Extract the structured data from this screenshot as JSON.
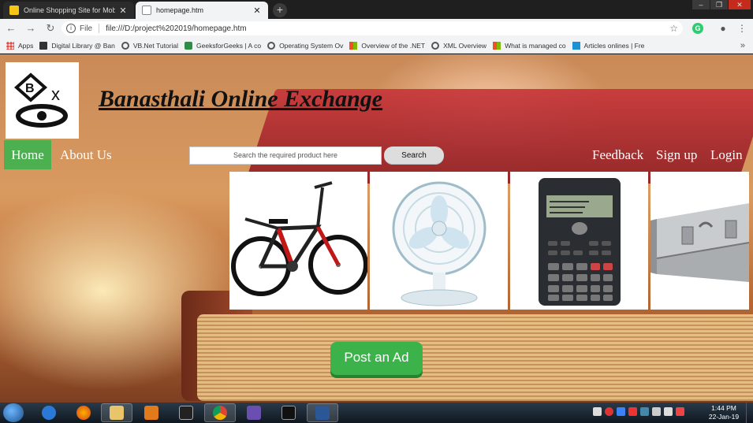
{
  "browser": {
    "tabs": [
      {
        "title": "Online Shopping Site for Mobiles",
        "active": false
      },
      {
        "title": "homepage.htm",
        "active": true
      }
    ],
    "new_tab_label": "+",
    "address": {
      "scheme": "File",
      "url": "file:///D:/project%202019/homepage.htm"
    },
    "bookmarks": [
      {
        "label": "Apps",
        "icon": "apps-grid-icon"
      },
      {
        "label": "Digital Library @ Ban",
        "icon": "bookmark-d-icon"
      },
      {
        "label": "VB.Net Tutorial",
        "icon": "gear-icon"
      },
      {
        "label": "GeeksforGeeks | A co",
        "icon": "gfg-icon"
      },
      {
        "label": "Operating System Ov",
        "icon": "gear-icon"
      },
      {
        "label": "Overview of the .NET",
        "icon": "ms-icon"
      },
      {
        "label": "XML Overview",
        "icon": "gear-icon"
      },
      {
        "label": "What is managed co",
        "icon": "ms-icon"
      },
      {
        "label": "Articles onlines | Fre",
        "icon": "articles-icon"
      }
    ],
    "bookmarks_more": "»"
  },
  "site": {
    "title": "Banasthali Online Exchange",
    "nav": {
      "home": "Home",
      "about": "About Us",
      "feedback": "Feedback",
      "signup": "Sign up",
      "login": "Login"
    },
    "search": {
      "placeholder": "Search the required product here",
      "button": "Search"
    },
    "products": [
      "bicycle-image",
      "table-fan-image",
      "scientific-calculator-image",
      "metal-trunk-image"
    ],
    "post_ad": "Post an Ad"
  },
  "taskbar": {
    "time": "1:44 PM",
    "date": "22-Jan-19"
  },
  "colors": {
    "nav_active": "#4caf50",
    "post_ad": "#3cb34a"
  }
}
